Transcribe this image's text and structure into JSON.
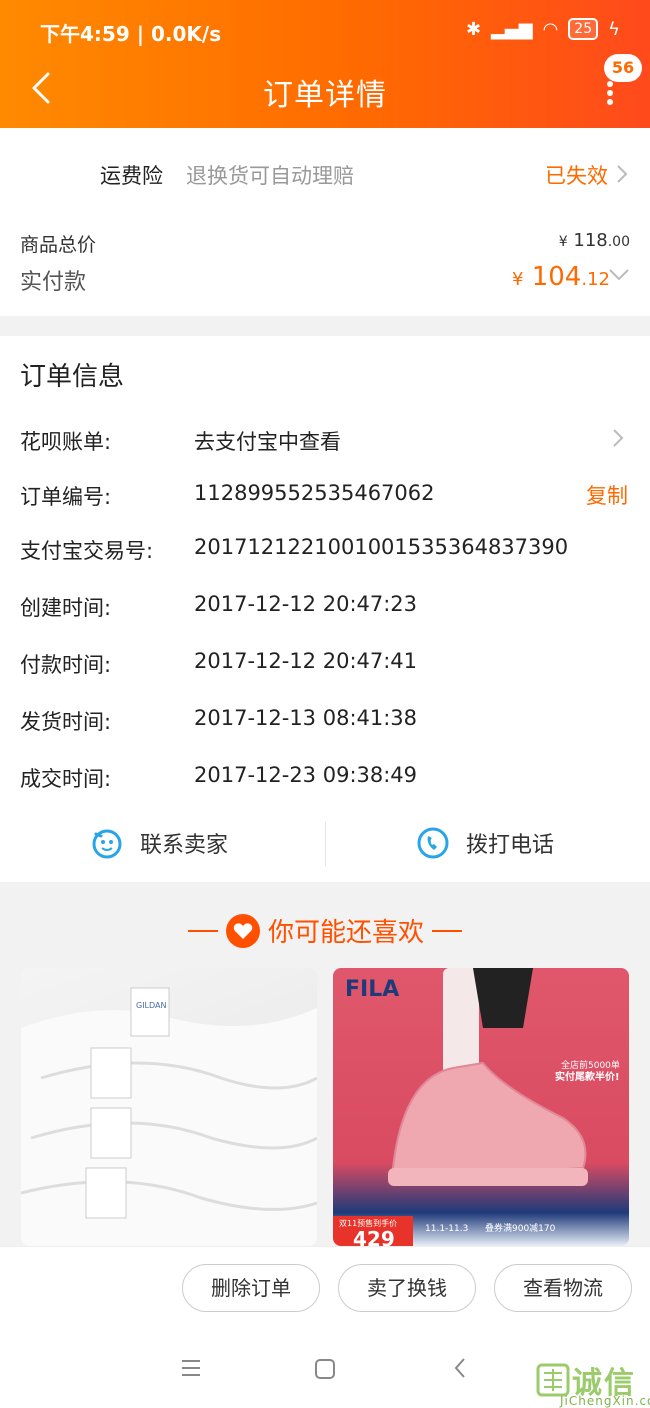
{
  "status_bar": {
    "time": "下午4:59 | 0.0K/s",
    "battery": "25"
  },
  "header": {
    "title": "订单详情",
    "badge_count": "56",
    "brand_color": "#ff6a00"
  },
  "insurance": {
    "label": "运费险",
    "desc": "退换货可自动理赔",
    "status": "已失效"
  },
  "price": {
    "goods_total_label": "商品总价",
    "goods_total_int": "118",
    "goods_total_dec": ".00",
    "paid_label": "实付款",
    "paid_symbol": "¥",
    "paid_int": "104",
    "paid_dec": ".12",
    "currency": "¥"
  },
  "order_info": {
    "title": "订单信息",
    "rows": [
      {
        "label": "花呗账单:",
        "value": "去支付宝中查看"
      },
      {
        "label": "订单编号:",
        "value": "112899552535467062"
      },
      {
        "label": "支付宝交易号:",
        "value": "2017121221001001535364837390"
      },
      {
        "label": "创建时间:",
        "value": "2017-12-12 20:47:23"
      },
      {
        "label": "付款时间:",
        "value": "2017-12-12 20:47:41"
      },
      {
        "label": "发货时间:",
        "value": "2017-12-13 08:41:38"
      },
      {
        "label": "成交时间:",
        "value": "2017-12-23 09:38:49"
      }
    ],
    "copy_label": "复制"
  },
  "contact": {
    "seller_label": "联系卖家",
    "phone_label": "拨打电话"
  },
  "recommend": {
    "title": "你可能还喜欢",
    "left_tag": "GILDAN",
    "right_brand": "FILA",
    "right_promo_1": "全店前5000单",
    "right_promo_2": "实付尾款半价!",
    "right_presale": "双11预售到手价",
    "right_price": "429",
    "right_dates": "11.1-11.3",
    "right_deal": "叠券满900减170"
  },
  "actions": {
    "delete": "删除订单",
    "sell": "卖了换钱",
    "logistics": "查看物流"
  },
  "watermark": {
    "text": "诚信",
    "url": "JiChengXin.com"
  }
}
